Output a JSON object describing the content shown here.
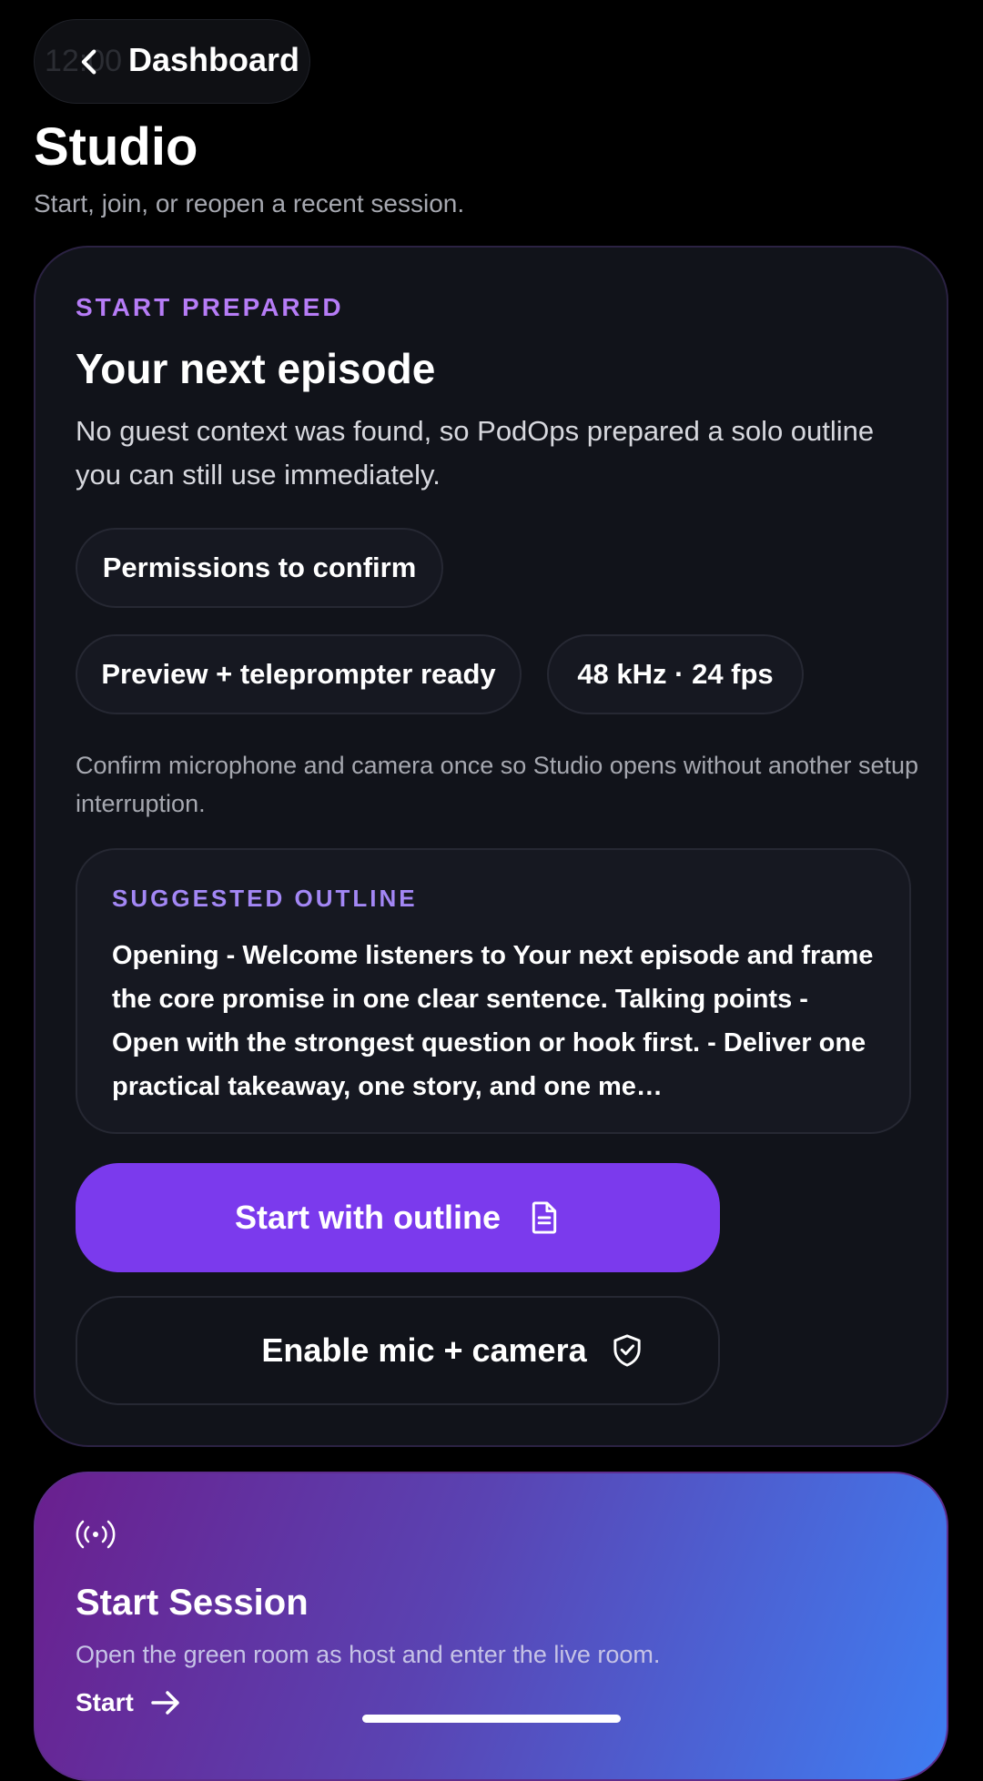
{
  "header": {
    "ghost_time": "12:00",
    "back_label": "Dashboard",
    "title": "Studio",
    "subtitle": "Start, join, or reopen a recent session."
  },
  "prepared_card": {
    "eyebrow": "START PREPARED",
    "title": "Your next episode",
    "description": "No guest context was found, so PodOps prepared a solo outline you can still use immediately.",
    "chips": [
      "Permissions to confirm",
      "Preview + teleprompter ready",
      "48 kHz · 24 fps"
    ],
    "permission_note": "Confirm microphone and camera once so Studio opens without another setup interruption.",
    "outline": {
      "label": "SUGGESTED OUTLINE",
      "text": "Opening - Welcome listeners to Your next episode and frame the core promise in one clear sentence. Talking points - Open with the strongest question or hook first. - Deliver one practical takeaway, one story, and one me…"
    },
    "primary_button": "Start with outline",
    "secondary_button": "Enable mic + camera"
  },
  "session_card": {
    "title": "Start Session",
    "description": "Open the green room as host and enter the live room.",
    "link": "Start"
  },
  "colors": {
    "background": "#000000",
    "card": "#11131a",
    "accent": "#7b3aed",
    "eyebrow": "#b67cf6",
    "gradient_start": "#6a1f8e",
    "gradient_end": "#3f7ef2"
  },
  "icons": {
    "back": "chevron-left-icon",
    "outline": "document-icon",
    "permissions": "shield-check-icon",
    "session": "broadcast-icon",
    "start": "arrow-right-icon"
  }
}
